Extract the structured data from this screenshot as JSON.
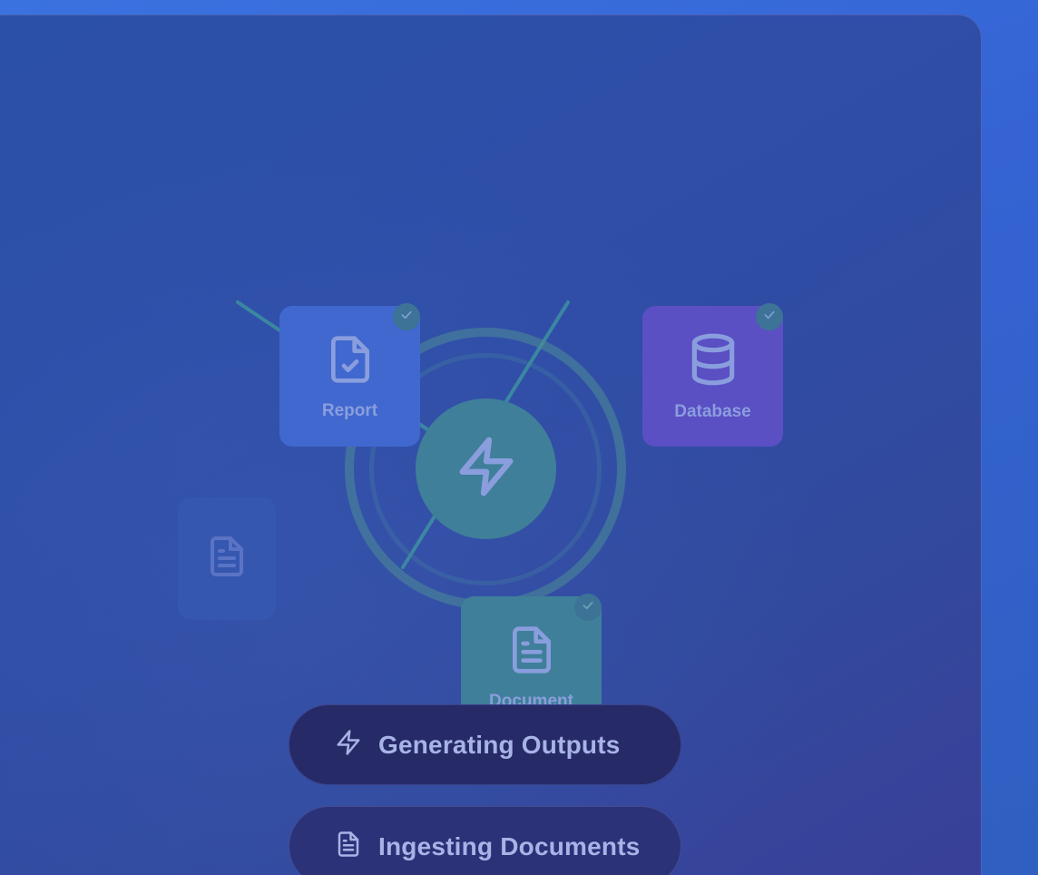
{
  "pipeline": {
    "hub": {
      "icon": "lightning-bolt-icon"
    },
    "nodes": [
      {
        "id": "report",
        "label": "Report",
        "icon": "file-check-icon",
        "completed": true
      },
      {
        "id": "database",
        "label": "Database",
        "icon": "database-icon",
        "completed": true
      },
      {
        "id": "document",
        "label": "Document",
        "icon": "file-text-icon",
        "completed": true
      },
      {
        "id": "pending",
        "label": "",
        "icon": "file-text-icon",
        "completed": false
      }
    ]
  },
  "status_steps": [
    {
      "label": "Generating Outputs",
      "icon": "lightning-bolt-icon",
      "state": "active"
    },
    {
      "label": "Ingesting Documents",
      "icon": "file-text-icon",
      "state": "inactive"
    }
  ],
  "colors": {
    "background": "#3563d4",
    "panel": "#2e4ea8",
    "hub": "#3f7f9a",
    "report_card": "#4068cf",
    "database_card": "#5b4fc4",
    "document_card": "#3f7f9a",
    "active_pill": "#262b68",
    "accent_line": "#3f9aa0"
  }
}
